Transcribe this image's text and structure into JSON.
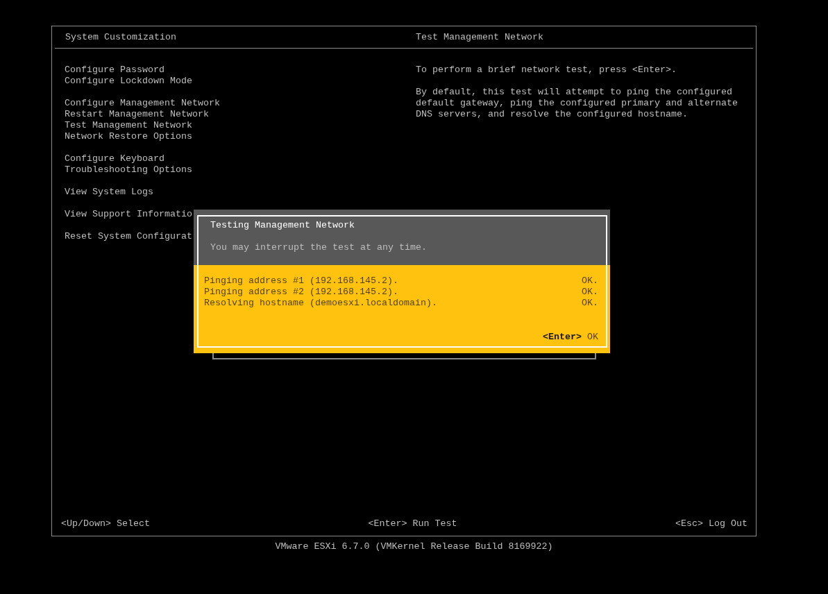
{
  "left_title": "System Customization",
  "right_title": "Test Management Network",
  "menu_groups": [
    {
      "items": [
        {
          "label": "Configure Password",
          "selected": false
        },
        {
          "label": "Configure Lockdown Mode",
          "selected": false
        }
      ]
    },
    {
      "items": [
        {
          "label": "Configure Management Network",
          "selected": false
        },
        {
          "label": "Restart Management Network",
          "selected": false
        },
        {
          "label": "Test Management Network",
          "selected": false
        },
        {
          "label": "Network Restore Options",
          "selected": false
        }
      ]
    },
    {
      "items": [
        {
          "label": "Configure Keyboard",
          "selected": false
        },
        {
          "label": "Troubleshooting Options",
          "selected": false
        }
      ]
    },
    {
      "items": [
        {
          "label": "View System Logs",
          "selected": false
        }
      ]
    },
    {
      "items": [
        {
          "label": "View Support Informatio",
          "selected": false
        }
      ]
    },
    {
      "items": [
        {
          "label": "Reset System Configurat",
          "selected": false
        }
      ]
    }
  ],
  "description": [
    "To perform a brief network test, press <Enter>.",
    "By default, this test will attempt to ping the configured default gateway, ping the configured primary and alternate DNS servers, and resolve the configured hostname."
  ],
  "dialog": {
    "title": "Testing Management Network",
    "subtitle": "You may interrupt the test at any time.",
    "results": [
      {
        "text": "Pinging address #1 (192.168.145.2).",
        "status": "OK."
      },
      {
        "text": "Pinging address #2 (192.168.145.2).",
        "status": "OK."
      },
      {
        "text": "Resolving hostname (demoesxi.localdomain).",
        "status": "OK."
      }
    ],
    "action": {
      "key": "<Enter>",
      "label": "OK"
    }
  },
  "footer": {
    "left": "<Up/Down> Select",
    "center": "<Enter> Run Test",
    "right": "<Esc> Log Out"
  },
  "version": "VMware ESXi 6.7.0 (VMKernel Release Build 8169922)"
}
